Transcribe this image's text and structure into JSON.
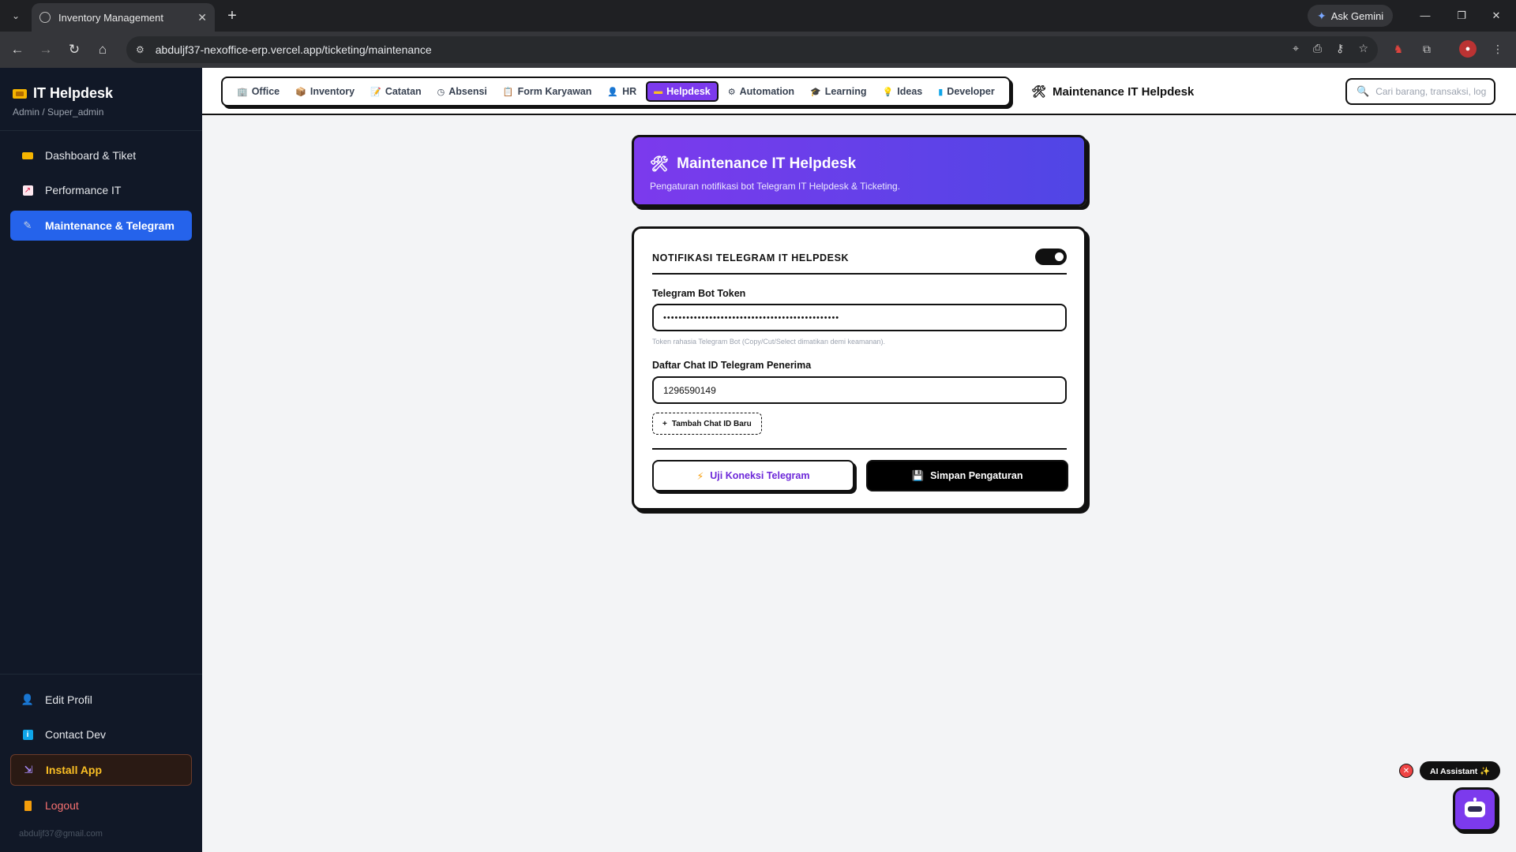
{
  "browser": {
    "tab_title": "Inventory Management",
    "url": "abduljf37-nexoffice-erp.vercel.app/ticketing/maintenance",
    "gemini_label": "Ask Gemini"
  },
  "sidebar": {
    "title": "IT Helpdesk",
    "subtitle": "Admin / Super_admin",
    "items": [
      {
        "label": "Dashboard & Tiket",
        "icon": "ticket-icon"
      },
      {
        "label": "Performance IT",
        "icon": "chart-icon"
      },
      {
        "label": "Maintenance & Telegram",
        "icon": "tools-icon",
        "active": true
      }
    ],
    "bottom_items": [
      {
        "label": "Edit Profil",
        "icon": "user-icon"
      },
      {
        "label": "Contact Dev",
        "icon": "info-icon"
      },
      {
        "label": "Install App",
        "icon": "install-icon"
      },
      {
        "label": "Logout",
        "icon": "logout-icon"
      }
    ],
    "email": "abduljf37@gmail.com"
  },
  "topnav": {
    "modules": [
      {
        "label": "Office",
        "icon": "office-icon"
      },
      {
        "label": "Inventory",
        "icon": "box-icon"
      },
      {
        "label": "Catatan",
        "icon": "note-icon"
      },
      {
        "label": "Absensi",
        "icon": "clock-icon"
      },
      {
        "label": "Form Karyawan",
        "icon": "form-icon"
      },
      {
        "label": "HR",
        "icon": "person-icon"
      },
      {
        "label": "Helpdesk",
        "icon": "ticket-icon",
        "active": true
      },
      {
        "label": "Automation",
        "icon": "gear-icon"
      },
      {
        "label": "Learning",
        "icon": "graduation-icon"
      },
      {
        "label": "Ideas",
        "icon": "bulb-icon"
      },
      {
        "label": "Developer",
        "icon": "book-icon"
      }
    ],
    "page_title": "Maintenance IT Helpdesk",
    "search_placeholder": "Cari barang, transaksi, log..."
  },
  "hero": {
    "title": "Maintenance IT Helpdesk",
    "subtitle": "Pengaturan notifikasi bot Telegram IT Helpdesk & Ticketing."
  },
  "settings": {
    "section_title": "NOTIFIKASI TELEGRAM IT HELPDESK",
    "notifications_enabled": true,
    "token_label": "Telegram Bot Token",
    "token_masked": "••••••••••••••••••••••••••••••••••••••••••••••",
    "token_hint": "Token rahasia Telegram Bot (Copy/Cut/Select dimatikan demi keamanan).",
    "chat_label": "Daftar Chat ID Telegram Penerima",
    "chat_ids": [
      "1296590149"
    ],
    "add_chat_label": "Tambah Chat ID Baru",
    "test_button": "Uji Koneksi Telegram",
    "save_button": "Simpan Pengaturan"
  },
  "assistant": {
    "label": "AI Assistant ✨"
  },
  "colors": {
    "accent": "#7c3aed",
    "sidebar_bg": "#111827",
    "sidebar_active": "#2563eb",
    "logout": "#f87171"
  }
}
